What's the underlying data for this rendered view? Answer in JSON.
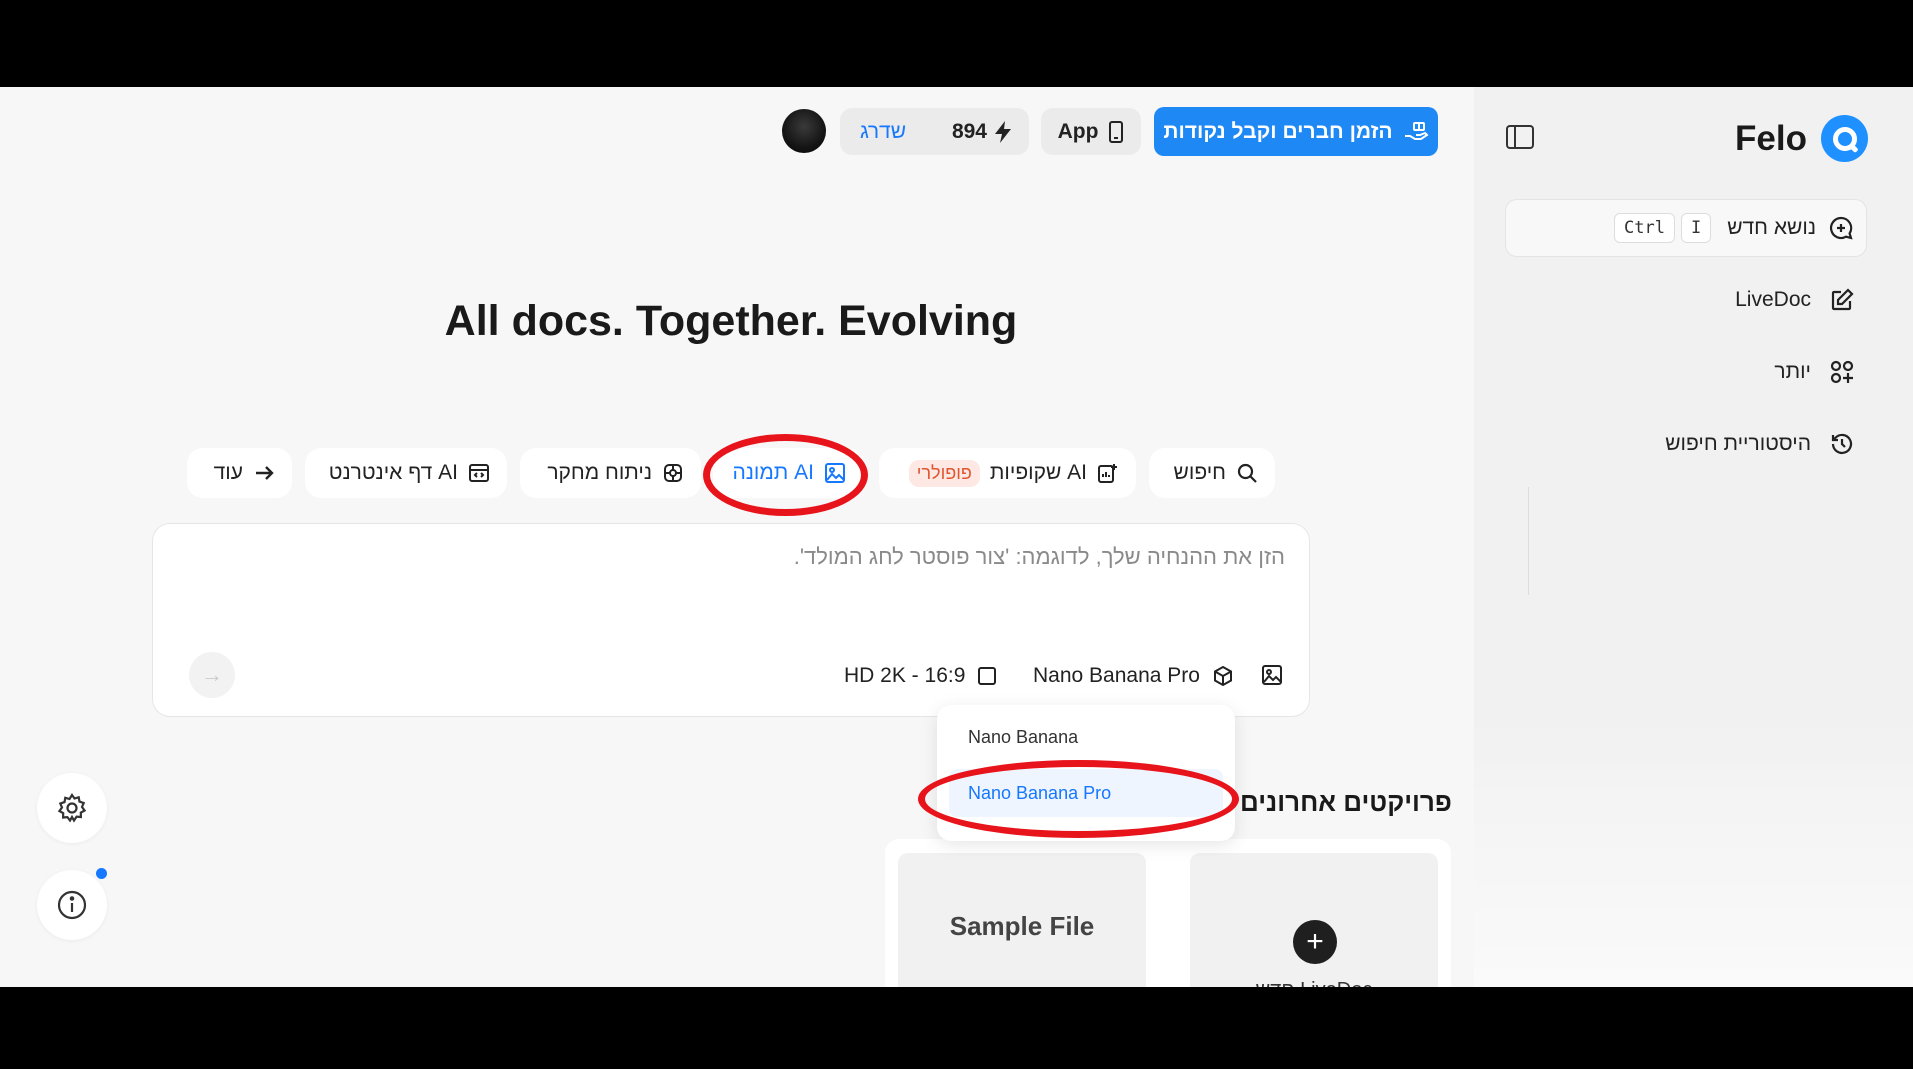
{
  "brand": {
    "name": "Felo"
  },
  "sidebar": {
    "new_topic": {
      "label": "נושא חדש",
      "shortcut_keys": [
        "Ctrl",
        "I"
      ]
    },
    "items": [
      {
        "label": "LiveDoc",
        "icon": "edit-icon"
      },
      {
        "label": "יותר",
        "icon": "apps-icon"
      },
      {
        "label": "היסטוריית חיפוש",
        "icon": "history-icon"
      }
    ]
  },
  "header": {
    "points": "894",
    "upgrade_label": "שדרג",
    "app_label": "App",
    "invite_label": "הזמן חברים וקבל נקודות"
  },
  "hero": {
    "title": "All docs. Together. Evolving"
  },
  "tabs": [
    {
      "label": "חיפוש",
      "icon": "search-icon"
    },
    {
      "label": "שקופיות AI",
      "badge": "פופולרי",
      "icon": "slides-icon"
    },
    {
      "label": "תמונה AI",
      "icon": "image-icon",
      "active": true
    },
    {
      "label": "ניתוח מחקר",
      "icon": "research-icon"
    },
    {
      "label": "דף אינטרנט AI",
      "icon": "webpage-icon"
    },
    {
      "label": "עוד",
      "icon": "arrow-right-icon"
    }
  ],
  "prompt": {
    "placeholder": "הזן את ההנחיה שלך, לדוגמה: 'צור פוסטר לחג המולד'.",
    "model_label": "Nano Banana Pro",
    "ratio_label": "HD 2K - 16:9"
  },
  "model_dropdown": {
    "options": [
      "Nano Banana",
      "Nano Banana Pro"
    ],
    "selected": "Nano Banana Pro"
  },
  "recent": {
    "title": "פרויקטים אחרונים",
    "sample_label": "Sample File",
    "new_label": "LiveDoc חדש"
  },
  "colors": {
    "accent": "#1677ff",
    "highlight_ring": "#e8141b",
    "badge_text": "#e0542e"
  }
}
